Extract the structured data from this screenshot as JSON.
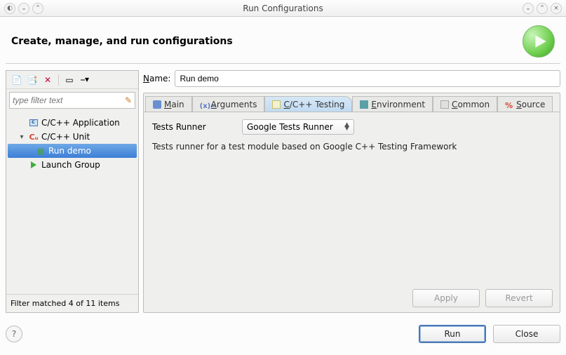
{
  "window": {
    "title": "Run Configurations"
  },
  "header": {
    "title": "Create, manage, and run configurations"
  },
  "left": {
    "filter_placeholder": "type filter text",
    "tree": [
      {
        "id": "cpp-app",
        "label": "C/C++ Application",
        "icon": "box",
        "depth": 1,
        "expandable": false
      },
      {
        "id": "cpp-unit",
        "label": "C/C++ Unit",
        "icon": "cu",
        "depth": 1,
        "expandable": true,
        "expanded": true
      },
      {
        "id": "run-demo",
        "label": "Run demo",
        "icon": "run",
        "depth": 2,
        "selected": true
      },
      {
        "id": "launch-group",
        "label": "Launch Group",
        "icon": "play",
        "depth": 1,
        "expandable": false
      }
    ],
    "filter_status": "Filter matched 4 of 11 items"
  },
  "name_field": {
    "label": "Name:",
    "accesskey": "N",
    "value": "Run demo"
  },
  "tabs": [
    {
      "id": "main",
      "label": "Main",
      "accesskey": "M",
      "icon": "main",
      "active": false
    },
    {
      "id": "arguments",
      "label": "Arguments",
      "accesskey": "A",
      "icon": "args",
      "active": false
    },
    {
      "id": "testing",
      "label": "C/C++ Testing",
      "accesskey": "C",
      "icon": "test",
      "active": true
    },
    {
      "id": "env",
      "label": "Environment",
      "accesskey": "E",
      "icon": "env",
      "active": false
    },
    {
      "id": "common",
      "label": "Common",
      "accesskey": "C",
      "icon": "common",
      "active": false
    },
    {
      "id": "source",
      "label": "Source",
      "accesskey": "S",
      "icon": "source",
      "active": false
    }
  ],
  "testing_tab": {
    "tests_runner_label": "Tests Runner",
    "tests_runner_value": "Google Tests Runner",
    "description": "Tests runner for a test module based on Google C++ Testing Framework"
  },
  "buttons": {
    "apply": "Apply",
    "revert": "Revert",
    "run": "Run",
    "close": "Close"
  }
}
